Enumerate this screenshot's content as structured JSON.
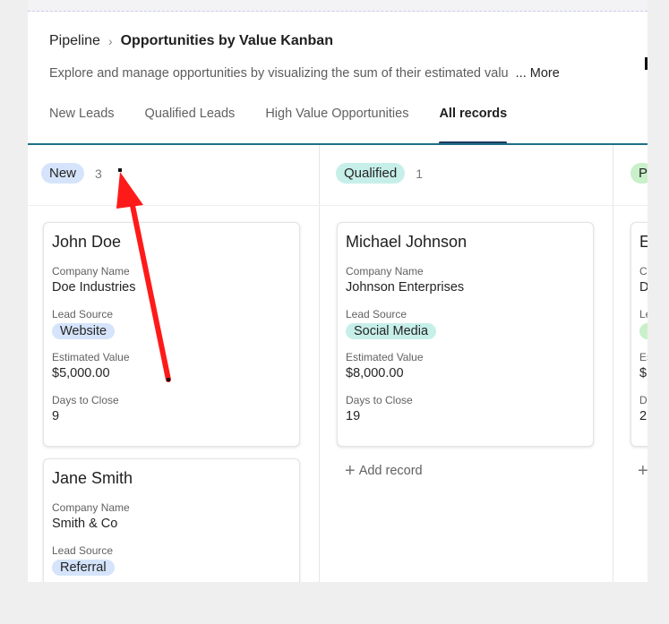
{
  "breadcrumb": {
    "root": "Pipeline",
    "current": "Opportunities by Value Kanban"
  },
  "description": {
    "text": "Explore and manage opportunities by visualizing the sum of their estimated valu",
    "more": "... More"
  },
  "tabs": [
    {
      "label": "New Leads"
    },
    {
      "label": "Qualified Leads"
    },
    {
      "label": "High Value Opportunities"
    },
    {
      "label": "All records",
      "active": true
    }
  ],
  "columns": {
    "new": {
      "label": "New",
      "count": "3",
      "cards": [
        {
          "name": "John Doe",
          "company_label": "Company Name",
          "company": "Doe Industries",
          "source_label": "Lead Source",
          "source": "Website",
          "value_label": "Estimated Value",
          "value": "$5,000.00",
          "days_label": "Days to Close",
          "days": "9"
        },
        {
          "name": "Jane Smith",
          "company_label": "Company Name",
          "company": "Smith & Co",
          "source_label": "Lead Source",
          "source": "Referral"
        }
      ]
    },
    "qualified": {
      "label": "Qualified",
      "count": "1",
      "cards": [
        {
          "name": "Michael Johnson",
          "company_label": "Company Name",
          "company": "Johnson Enterprises",
          "source_label": "Lead Source",
          "source": "Social Media",
          "value_label": "Estimated Value",
          "value": "$8,000.00",
          "days_label": "Days to Close",
          "days": "19"
        }
      ],
      "add_record": "Add record"
    },
    "third": {
      "label": "Pr",
      "card_initial": "E",
      "partial_letters": [
        "C",
        "D",
        "Le",
        "Es",
        "$",
        "D",
        "2"
      ]
    }
  },
  "colors": {
    "accent_line": "#1f6f86",
    "active_tab": "#1b3a5f",
    "arrow": "#ff1a1a"
  }
}
